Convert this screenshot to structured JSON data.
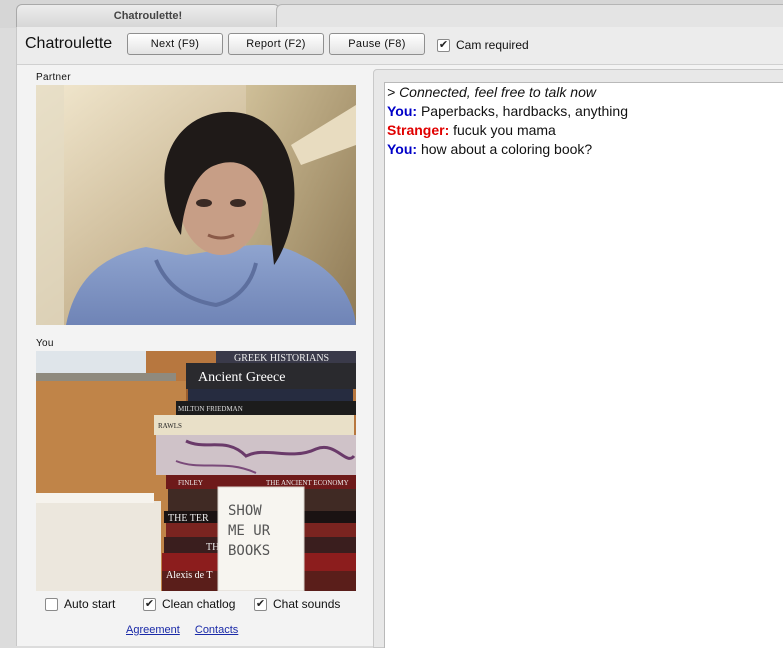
{
  "window": {
    "tab_title": "Chatroulette!"
  },
  "toolbar": {
    "logo": "Chatroulette",
    "next_label": "Next (F9)",
    "report_label": "Report (F2)",
    "pause_label": "Pause (F8)",
    "cam_required_label": "Cam required",
    "cam_required_checked": true
  },
  "videos": {
    "partner_label": "Partner",
    "you_label": "You"
  },
  "note": {
    "lines": [
      "SHOW",
      "ME UR",
      "BOOKS"
    ]
  },
  "books": [
    "GREEK HISTORIANS",
    "Ancient Greece",
    "MILTON FRIEDMAN",
    "RAWLS",
    "FINLEY",
    "THE ANCIENT ECONOMY",
    "THE TER",
    "THE",
    "Alexis de T"
  ],
  "options": [
    {
      "label": "Auto start",
      "checked": false
    },
    {
      "label": "Clean chatlog",
      "checked": true
    },
    {
      "label": "Chat sounds",
      "checked": true
    }
  ],
  "links": {
    "agreement": "Agreement",
    "contacts": "Contacts"
  },
  "chat": {
    "status": "> Connected, feel free to talk now",
    "messages": [
      {
        "speaker": "You:",
        "text": " Paperbacks, hardbacks, anything"
      },
      {
        "speaker": "Stranger:",
        "text": " fucuk you mama"
      },
      {
        "speaker": "You:",
        "text": " how about a coloring book?"
      }
    ]
  },
  "colors": {
    "you": "#0000c8",
    "stranger": "#e00000",
    "link": "#1a2aa8"
  }
}
